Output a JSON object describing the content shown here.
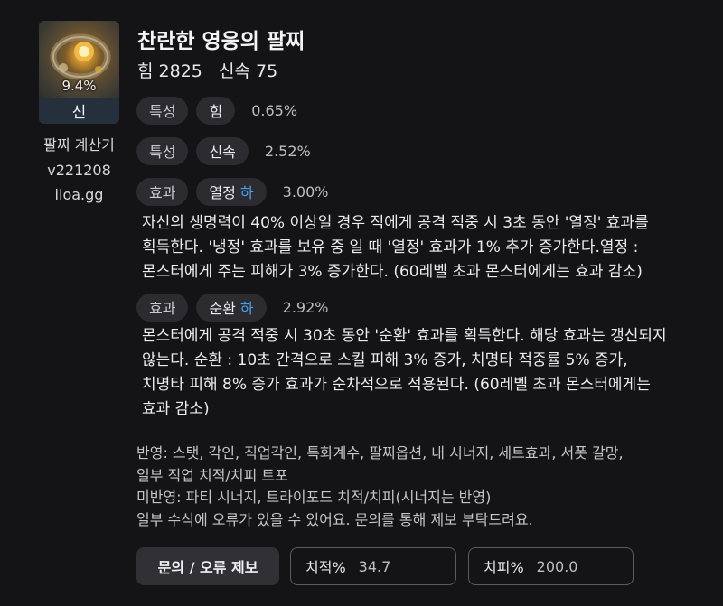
{
  "item": {
    "name": "찬란한 영웅의 팔찌",
    "stats": "힘 2825   신속 75",
    "quality_percent": "9.4%",
    "grade": "신"
  },
  "calculator": {
    "name": "팔찌 계산기",
    "version": "v221208",
    "site": "iloa.gg"
  },
  "options": [
    {
      "type": "특성",
      "name": "힘",
      "grade": "",
      "value": "0.65%"
    },
    {
      "type": "특성",
      "name": "신속",
      "grade": "",
      "value": "2.52%"
    },
    {
      "type": "효과",
      "name": "열정",
      "grade": "하",
      "value": "3.00%",
      "description_lines": [
        "자신의 생명력이 40% 이상일 경우 적에게 공격 적중 시 3초 동안 '열정' 효과를",
        "획득한다. '냉정' 효과를 보유 중 일 때 '열정' 효과가 1% 추가 증가한다.열정 :",
        "몬스터에게 주는 피해가 3% 증가한다. (60레벨 초과 몬스터에게는 효과 감소)"
      ]
    },
    {
      "type": "효과",
      "name": "순환",
      "grade": "하",
      "value": "2.92%",
      "description_lines": [
        "몬스터에게 공격 적중 시 30초 동안 '순환' 효과를 획득한다. 해당 효과는 갱신되지",
        "않는다. 순환 : 10초 간격으로 스킬 피해 3% 증가, 치명타 적중률 5% 증가,",
        "치명타 피해 8% 증가 효과가 순차적으로 적용된다. (60레벨 초과 몬스터에게는",
        "효과 감소)"
      ]
    }
  ],
  "notes": [
    "반영: 스탯, 각인, 직업각인, 특화계수, 팔찌옵션, 내 시너지, 세트효과, 서폿 갈망,",
    "일부 직업 치적/치피 트포",
    "미반영: 파티 시너지, 트라이포드 치적/치피(시너지는 반영)",
    "일부 수식에 오류가 있을 수 있어요. 문의를 통해 제보 부탁드려요."
  ],
  "footer": {
    "report_button": "문의 / 오류 제보",
    "crit_rate_label": "치적%",
    "crit_rate_value": "34.7",
    "crit_damage_label": "치피%",
    "crit_damage_value": "200.0"
  },
  "colors": {
    "background": "#141416",
    "pill": "#2b2b30",
    "grade_accent": "#4a9cf0",
    "grade_bar": "#26303d"
  }
}
